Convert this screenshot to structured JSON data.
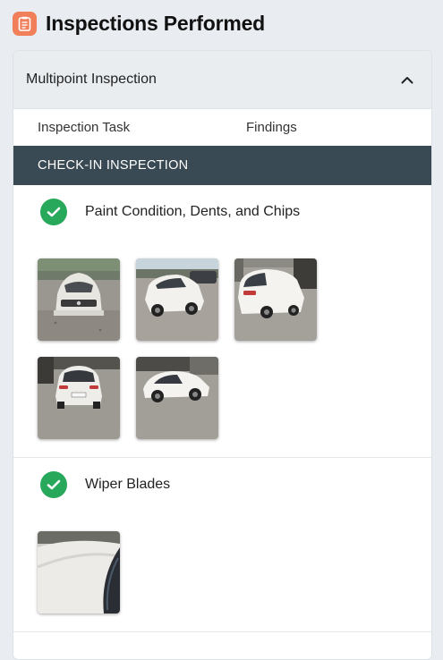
{
  "header": {
    "title": "Inspections Performed",
    "icon": "clipboard-icon",
    "icon_color": "#f07f5a"
  },
  "accordion": {
    "title": "Multipoint Inspection",
    "toggle_icon": "chevron-up-icon",
    "columns": {
      "task": "Inspection Task",
      "findings": "Findings"
    },
    "section": {
      "title": "CHECK-IN INSPECTION",
      "bar_color": "#3a4a54"
    },
    "tasks": [
      {
        "label": "Paint Condition, Dents, and Chips",
        "status_icon": "check-circle-icon",
        "status_color": "#27a85b",
        "photo_count": 5
      },
      {
        "label": "Wiper Blades",
        "status_icon": "check-circle-icon",
        "status_color": "#27a85b",
        "photo_count": 1
      }
    ]
  }
}
